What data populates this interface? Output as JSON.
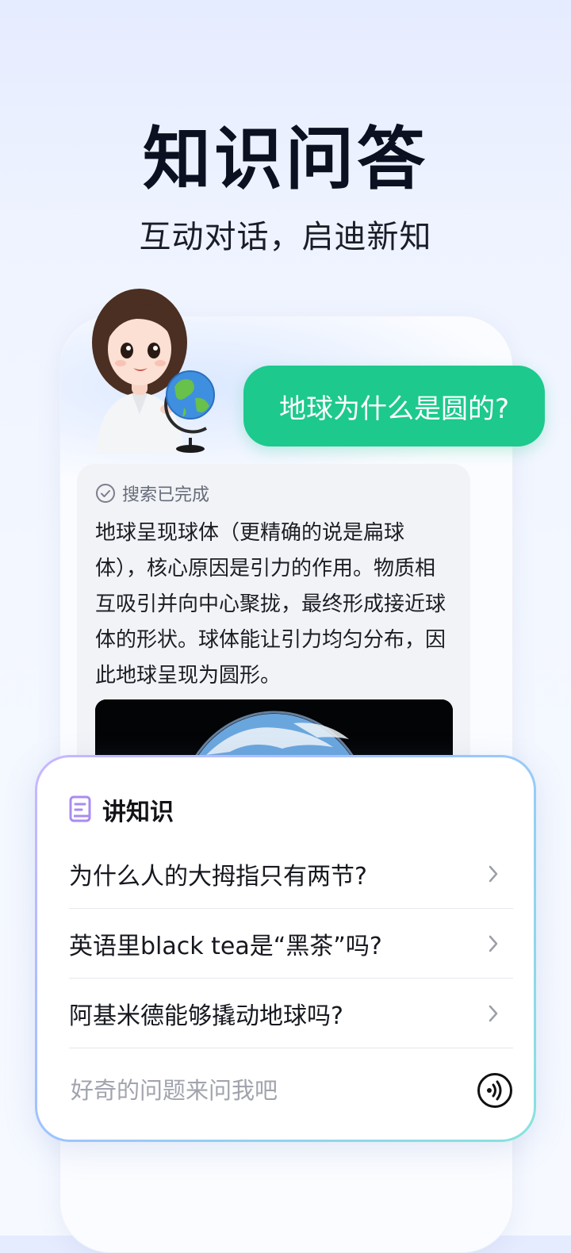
{
  "hero": {
    "title": "知识问答",
    "subtitle": "互动对话，启迪新知"
  },
  "chat": {
    "question": "地球为什么是圆的?",
    "search_status": "搜索已完成",
    "answer": "地球呈现球体（更精确的说是扁球体），核心原因是引力的作用。物质相互吸引并向中心聚拢，最终形成接近球体的形状。球体能让引力均匀分布，因此地球呈现为圆形。",
    "question_bubble_color": "#1dc98d"
  },
  "panel": {
    "title": "讲知识",
    "items": [
      {
        "label": "为什么人的大拇指只有两节?"
      },
      {
        "label": "英语里black tea是“黑茶”吗?"
      },
      {
        "label": "阿基米德能够撬动地球吗?"
      }
    ],
    "input_placeholder": "好奇的问题来问我吧"
  },
  "icons": {
    "status": "check-circle-icon",
    "panel": "book-icon",
    "row": "chevron-right-icon",
    "voice": "voice-call-icon"
  },
  "colors": {
    "accent_green": "#1dc98d",
    "panel_border_start": "#c9b6ff",
    "panel_border_end": "#86e3dc",
    "book_icon": "#a98cf0"
  }
}
